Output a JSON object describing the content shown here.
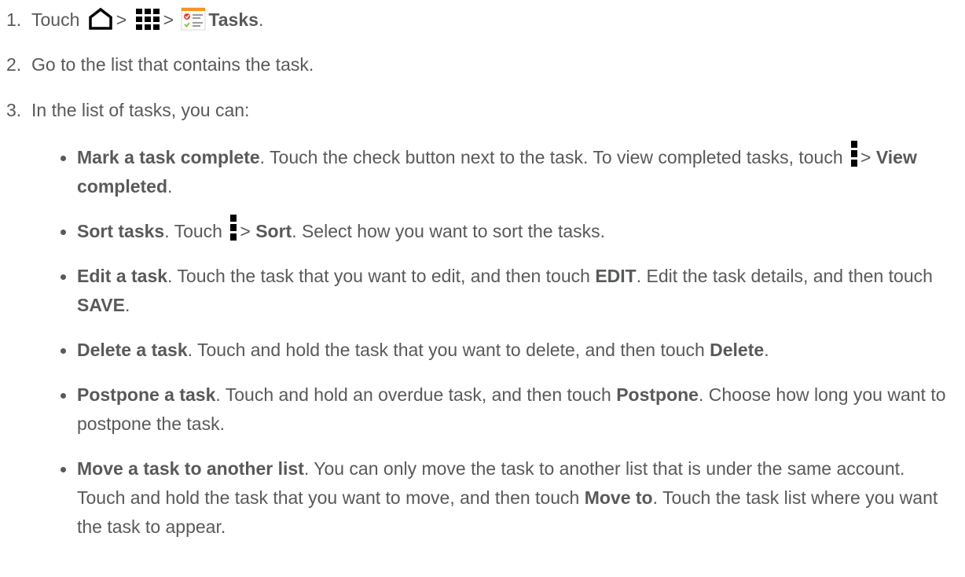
{
  "steps": [
    {
      "num": "1.",
      "touch": "Touch",
      "sep1": ">",
      "sep2": ">",
      "app": "Tasks",
      "end": "."
    },
    {
      "num": "2.",
      "text": "Go to the list that contains the task."
    },
    {
      "num": "3.",
      "text": "In the list of tasks, you can:"
    }
  ],
  "bullets": [
    {
      "title": "Mark a task complete",
      "parts": [
        ". Touch the check button next to the task. To view completed tasks, touch",
        ">",
        "View completed",
        "."
      ]
    },
    {
      "title": "Sort tasks",
      "parts": [
        ". Touch",
        ">",
        "Sort",
        ". Select how you want to sort the tasks."
      ]
    },
    {
      "title": "Edit a task",
      "parts": [
        ". Touch the task that you want to edit, and then touch",
        "EDIT",
        ". Edit the task details, and then touch",
        "SAVE",
        "."
      ]
    },
    {
      "title": "Delete a task",
      "parts": [
        ". Touch and hold the task that you want to delete, and then touch",
        "Delete",
        "."
      ]
    },
    {
      "title": "Postpone a task",
      "parts": [
        ". Touch and hold an overdue task, and then touch",
        "Postpone",
        ". Choose how long you want to postpone the task."
      ]
    },
    {
      "title": "Move a task to another list",
      "parts": [
        ". You can only move the task to another list that is under the same account. Touch and hold the task that you want to move, and then touch",
        "Move to",
        ". Touch the task list where you want the task to appear."
      ]
    }
  ],
  "icons": {
    "home": "home-icon",
    "apps": "apps-grid-icon",
    "tasks_app": "tasks-app-icon",
    "menu": "overflow-menu-icon"
  },
  "colors": {
    "text": "#58595b",
    "icon": "#000000",
    "tasks_accent_orange": "#f7941d",
    "tasks_accent_red": "#e8412c",
    "tasks_check_green": "#8dc63f"
  }
}
